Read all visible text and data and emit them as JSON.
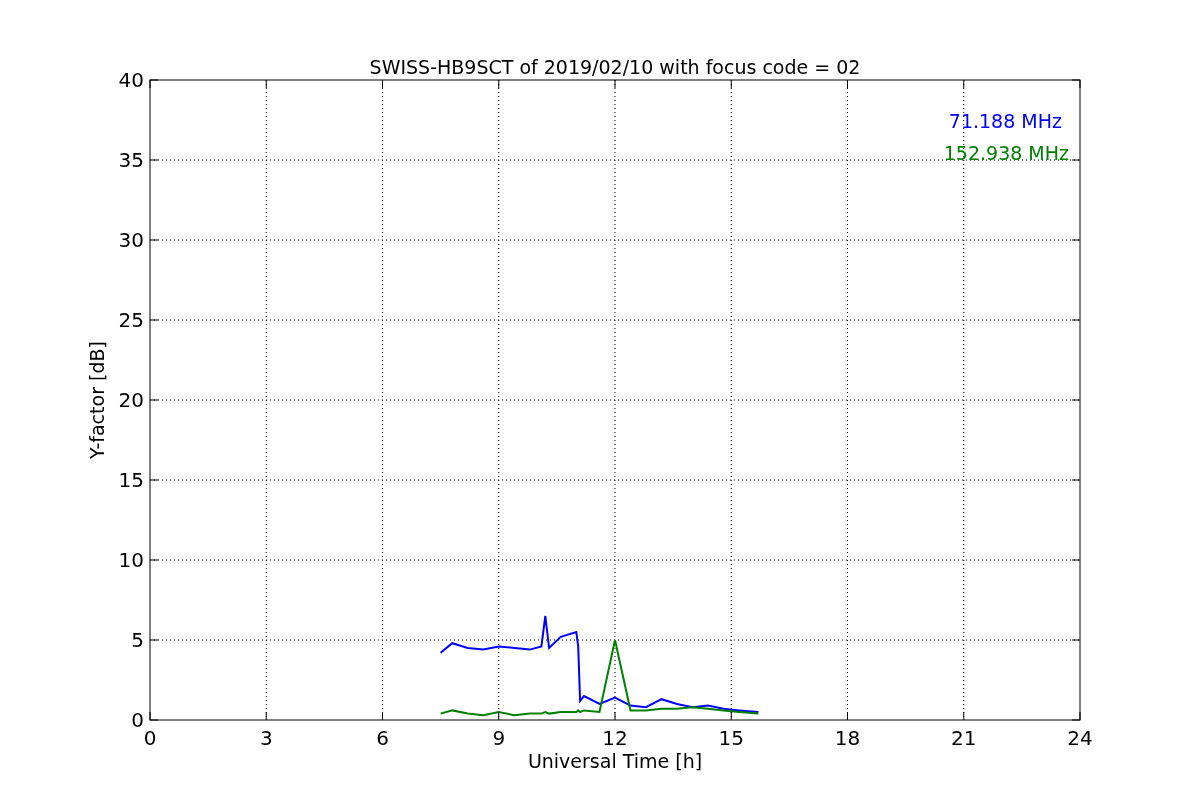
{
  "chart": {
    "chart_data": {
      "type": "line",
      "title": "SWISS-HB9SCT of 2019/02/10 with focus code = 02",
      "xlabel": "Universal Time [h]",
      "ylabel": "Y-factor [dB]",
      "x": [
        7.5,
        7.8,
        8.2,
        8.6,
        9,
        9.4,
        9.8,
        10.1,
        10.2,
        10.3,
        10.6,
        11,
        11.05,
        11.1,
        11.2,
        11.6,
        12,
        12.4,
        12.8,
        13.2,
        13.6,
        14,
        14.4,
        14.8,
        15.2,
        15.7
      ],
      "series": [
        {
          "name": "71.188 MHz",
          "color": "#0000ff",
          "values": [
            4.2,
            4.8,
            4.5,
            4.4,
            4.6,
            4.5,
            4.4,
            4.6,
            6.5,
            4.5,
            5.2,
            5.5,
            4.6,
            1.2,
            1.5,
            1.0,
            1.4,
            0.9,
            0.8,
            1.3,
            1.0,
            0.8,
            0.9,
            0.7,
            0.6,
            0.5
          ]
        },
        {
          "name": "152.938 MHz",
          "color": "#008000",
          "values": [
            0.4,
            0.6,
            0.4,
            0.3,
            0.5,
            0.3,
            0.4,
            0.4,
            0.5,
            0.4,
            0.5,
            0.5,
            0.6,
            0.5,
            0.6,
            0.5,
            5.0,
            0.6,
            0.6,
            0.7,
            0.7,
            0.8,
            0.7,
            0.6,
            0.5,
            0.4
          ]
        }
      ],
      "xlim": [
        0,
        24
      ],
      "ylim": [
        0,
        40
      ],
      "grid": true,
      "xticks": [
        0,
        3,
        6,
        9,
        12,
        15,
        18,
        21,
        24
      ],
      "yticks": [
        0,
        5,
        10,
        15,
        20,
        25,
        30,
        35,
        40
      ]
    }
  }
}
